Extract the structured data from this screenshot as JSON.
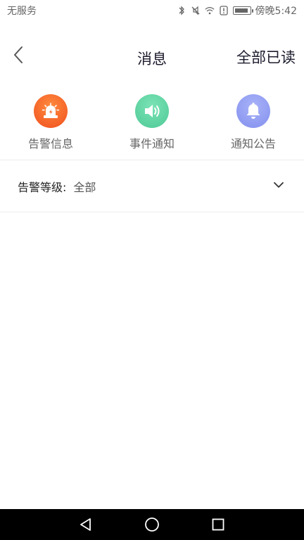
{
  "status_bar": {
    "carrier": "无服务",
    "time": "傍晚5:42",
    "icons": [
      "bluetooth-icon",
      "mute-icon",
      "wifi-icon",
      "alert-icon",
      "battery-icon"
    ]
  },
  "header": {
    "title": "消息",
    "mark_all_read": "全部已读",
    "back_icon": "chevron-left-icon"
  },
  "categories": [
    {
      "label": "告警信息",
      "icon": "siren-icon",
      "color": "#f5642a"
    },
    {
      "label": "事件通知",
      "icon": "speaker-icon",
      "color": "#5ed4a4"
    },
    {
      "label": "通知公告",
      "icon": "bell-icon",
      "color": "#8f9cf3"
    }
  ],
  "filter": {
    "label": "告警等级:",
    "value": "全部",
    "icon": "chevron-down-icon"
  },
  "system_nav": {
    "icons": [
      "back-triangle-icon",
      "home-circle-icon",
      "recents-square-icon"
    ]
  },
  "colors": {
    "alarm": "#f5642a",
    "event": "#5ed4a4",
    "notice": "#8f9cf3",
    "divider": "#ececec"
  }
}
